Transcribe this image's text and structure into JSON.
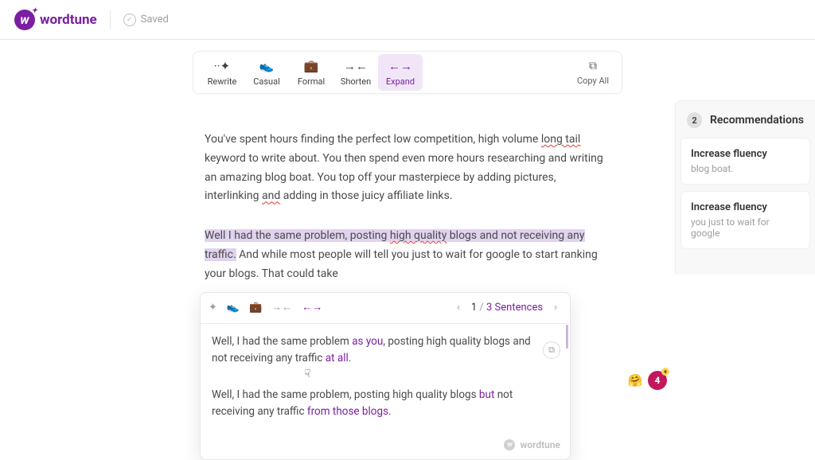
{
  "brand": {
    "name": "wordtune",
    "mark": "w"
  },
  "header": {
    "saved_label": "Saved"
  },
  "toolbar": {
    "rewrite": "Rewrite",
    "casual": "Casual",
    "formal": "Formal",
    "shorten": "Shorten",
    "expand": "Expand",
    "copy_all": "Copy All"
  },
  "document": {
    "para1_a": "You've spent hours finding the perfect low competition, high volume ",
    "long_tail": "long tail",
    "para1_b": " keyword to write about. You then spend even more hours researching and writing an amazing blog boat. You top off your masterpiece by adding pictures, interlinking ",
    "and_word": "and",
    "para1_c": " adding in those juicy affiliate links.",
    "sel_a": "Well I had the same problem, posting ",
    "sel_hq": "high quality",
    "sel_b": " blogs and not receiving any traffic.",
    "rest": " And while most people will tell you just to wait for google to start ranking your blogs. That could take"
  },
  "popup": {
    "pager_current": "1",
    "pager_total": "3 Sentences",
    "s1_a": "Well, I had the same problem ",
    "s1_p1": "as you",
    "s1_b": ", posting high quality blogs and not receiving any traffic ",
    "s1_p2": "at all",
    "s1_c": ".",
    "s2_a": "Well, I had the same problem, posting high quality blogs ",
    "s2_p1": "but",
    "s2_b": " not receiving any traffic ",
    "s2_p2": "from those blogs",
    "s2_c": ".",
    "footer_brand": "wordtune"
  },
  "side": {
    "count": "2",
    "title": "Recommendations",
    "items": [
      {
        "title": "Increase fluency",
        "snippet": "blog boat."
      },
      {
        "title": "Increase fluency",
        "snippet": "you just to wait for google"
      }
    ]
  },
  "reactions": {
    "emoji": "🤗",
    "count": "4"
  }
}
